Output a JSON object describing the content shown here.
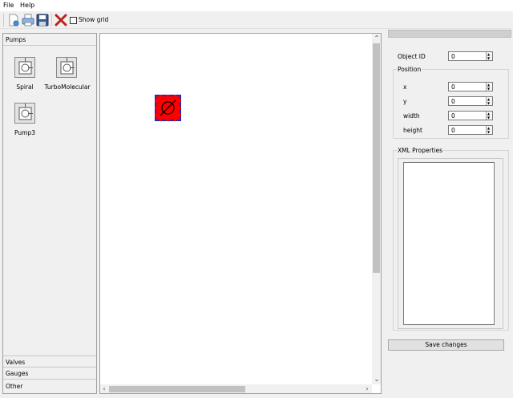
{
  "menubar": {
    "items": [
      {
        "label": "File"
      },
      {
        "label": "Help"
      }
    ]
  },
  "toolbar": {
    "new_icon": "new-document-icon",
    "print_icon": "print-icon",
    "save_icon": "save-icon",
    "delete_icon": "delete-icon",
    "show_grid_label": "Show grid",
    "show_grid_checked": false
  },
  "toolbox": {
    "categories": [
      {
        "label": "Pumps"
      },
      {
        "label": "Valves"
      },
      {
        "label": "Gauges"
      },
      {
        "label": "Other"
      }
    ],
    "pumps": [
      {
        "label": "Spiral"
      },
      {
        "label": "TurboMolecular"
      },
      {
        "label": "Pump3"
      }
    ]
  },
  "canvas": {
    "shape_color": "#ff0000",
    "shape_border_color": "#2a2aa8"
  },
  "properties": {
    "object_id_label": "Object ID",
    "object_id_value": "0",
    "position_group_label": "Position",
    "x_label": "x",
    "x_value": "0",
    "y_label": "y",
    "y_value": "0",
    "width_label": "width",
    "width_value": "0",
    "height_label": "height",
    "height_value": "0",
    "xml_group_label": "XML Properties",
    "save_button_label": "Save changes"
  }
}
